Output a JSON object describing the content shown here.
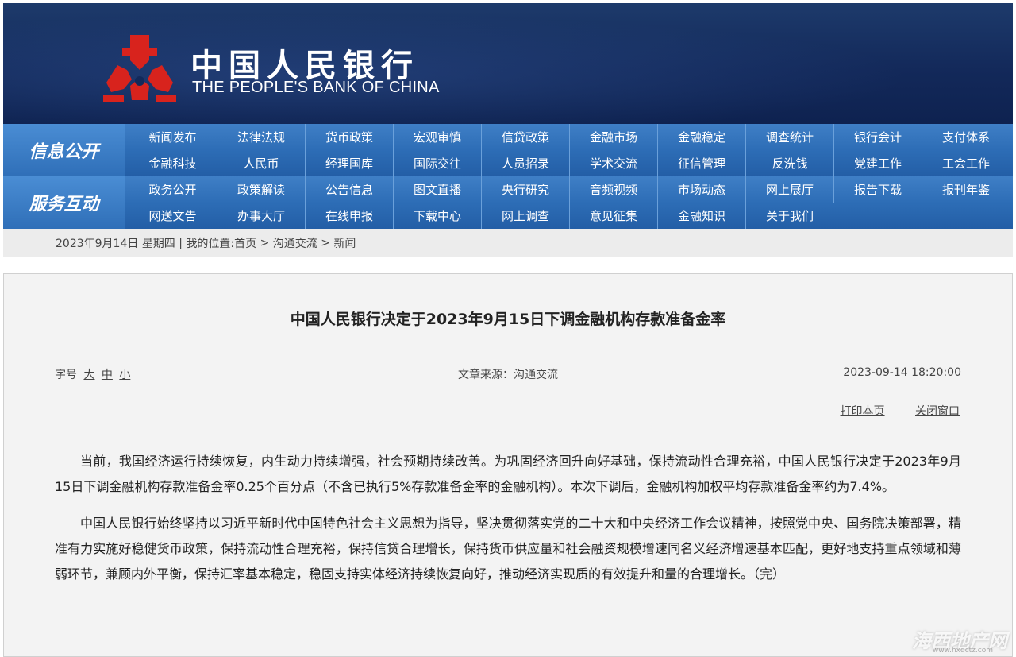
{
  "header": {
    "cn_name": "中国人民银行",
    "en_name": "THE PEOPLE'S BANK OF CHINA",
    "logo_icon": "pboc-logo-icon"
  },
  "nav": {
    "row1": {
      "label": "信息公开",
      "items": [
        "新闻发布",
        "法律法规",
        "货币政策",
        "宏观审慎",
        "信贷政策",
        "金融市场",
        "金融稳定",
        "调查统计",
        "银行会计",
        "支付体系",
        "金融科技",
        "人民币",
        "经理国库",
        "国际交往",
        "人员招录",
        "学术交流",
        "征信管理",
        "反洗钱",
        "党建工作",
        "工会工作"
      ]
    },
    "row2": {
      "label": "服务互动",
      "items": [
        "政务公开",
        "政策解读",
        "公告信息",
        "图文直播",
        "央行研究",
        "音频视频",
        "市场动态",
        "网上展厅",
        "报告下载",
        "报刊年鉴",
        "网送文告",
        "办事大厅",
        "在线申报",
        "下载中心",
        "网上调查",
        "意见征集",
        "金融知识",
        "关于我们"
      ]
    }
  },
  "breadcrumb": {
    "date": "2023年9月14日 星期四",
    "sep1": " | ",
    "location_label": "我的位置:",
    "home": "首页",
    "sep2": " > ",
    "section": "沟通交流",
    "sep3": " > ",
    "current": "新闻"
  },
  "article": {
    "title": "中国人民银行决定于2023年9月15日下调金融机构存款准备金率",
    "font_size_label": "字号",
    "font_large": "大",
    "font_medium": "中",
    "font_small": "小",
    "source": "文章来源：沟通交流",
    "datetime": "2023-09-14 18:20:00",
    "print": "打印本页",
    "close": "关闭窗口",
    "paragraphs": [
      "当前，我国经济运行持续恢复，内生动力持续增强，社会预期持续改善。为巩固经济回升向好基础，保持流动性合理充裕，中国人民银行决定于2023年9月15日下调金融机构存款准备金率0.25个百分点（不含已执行5%存款准备金率的金融机构）。本次下调后，金融机构加权平均存款准备金率约为7.4%。",
      "中国人民银行始终坚持以习近平新时代中国特色社会主义思想为指导，坚决贯彻落实党的二十大和中央经济工作会议精神，按照党中央、国务院决策部署，精准有力实施好稳健货币政策，保持流动性合理充裕，保持信贷合理增长，保持货币供应量和社会融资规模增速同名义经济增速基本匹配，更好地支持重点领域和薄弱环节，兼顾内外平衡，保持汇率基本稳定，稳固支持实体经济持续恢复向好，推动经济实现质的有效提升和量的合理增长。（完）"
    ]
  },
  "watermark": {
    "text": "海西地产网",
    "url": "www.hxdctz.com"
  }
}
